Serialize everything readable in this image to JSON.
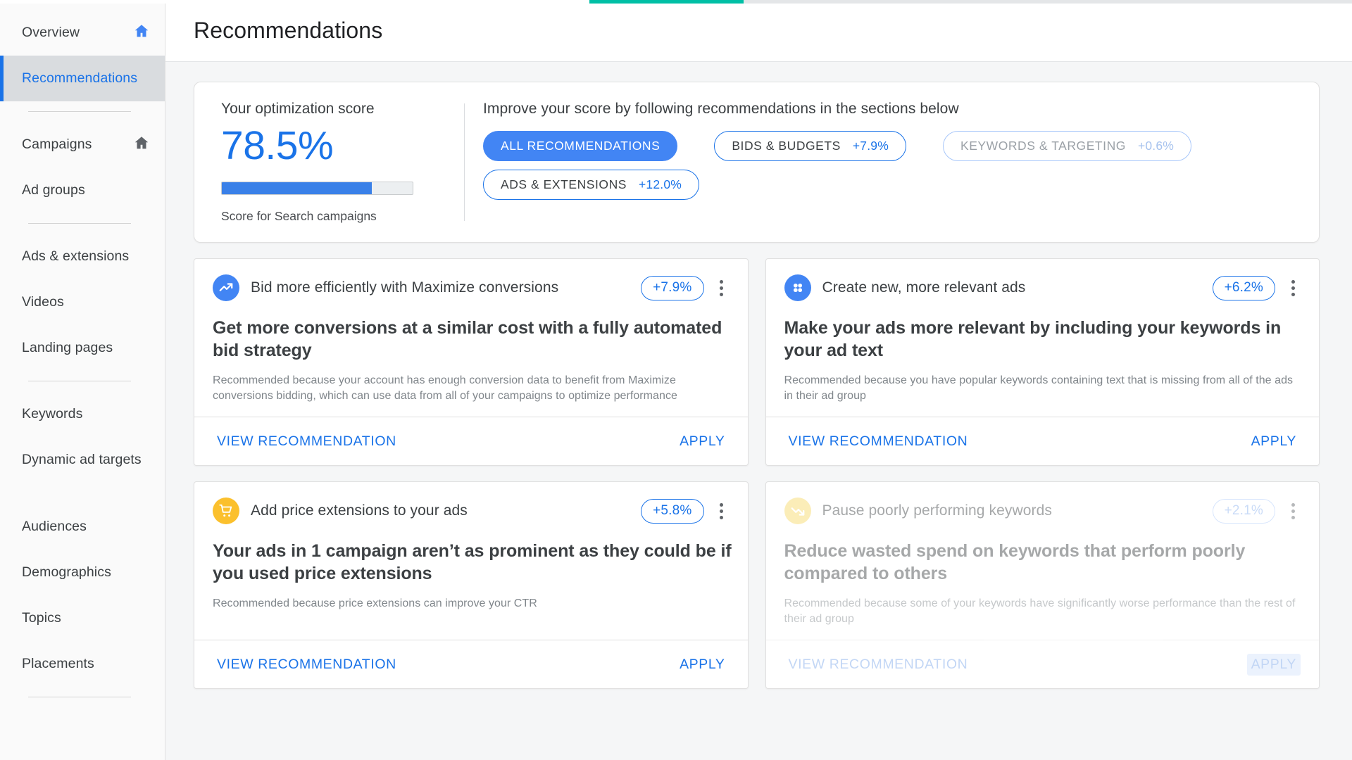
{
  "top_progress": {
    "color": "#00bfa5",
    "percent": 20
  },
  "sidebar": {
    "items": [
      {
        "label": "Overview",
        "icon": "home-icon",
        "icon_color": "#4285f4",
        "active": false,
        "has_icon": true
      },
      {
        "label": "Recommendations",
        "active": true,
        "has_icon": false
      },
      {
        "divider_after": true
      },
      {
        "label": "Campaigns",
        "icon": "home-icon",
        "icon_color": "#5f6368",
        "active": false,
        "has_icon": true
      },
      {
        "label": "Ad groups",
        "active": false,
        "has_icon": false
      },
      {
        "divider_after": true
      },
      {
        "label": "Ads  & extensions",
        "active": false,
        "has_icon": false
      },
      {
        "label": "Videos",
        "active": false,
        "has_icon": false
      },
      {
        "label": "Landing pages",
        "active": false,
        "has_icon": false
      },
      {
        "divider_after": true
      },
      {
        "label": "Keywords",
        "active": false,
        "has_icon": false
      },
      {
        "label": "Dynamic ad targets",
        "active": false,
        "has_icon": false
      },
      {
        "gap_after": true
      },
      {
        "label": "Audiences",
        "active": false,
        "has_icon": false
      },
      {
        "label": "Demographics",
        "active": false,
        "has_icon": false
      },
      {
        "label": "Topics",
        "active": false,
        "has_icon": false
      },
      {
        "label": "Placements",
        "active": false,
        "has_icon": false
      },
      {
        "divider_after": true
      }
    ]
  },
  "header": {
    "title": "Recommendations"
  },
  "score_card": {
    "label": "Your optimization score",
    "value": "78.5%",
    "progress_percent": 78.5,
    "sub_label": "Score for Search campaigns",
    "improve_text": "Improve your score by following recommendations in the sections below",
    "chips": [
      {
        "label": "ALL RECOMMENDATIONS",
        "delta": "",
        "style": "primary"
      },
      {
        "label": "BIDS & BUDGETS",
        "delta": "+7.9%",
        "style": "outline"
      },
      {
        "label": "KEYWORDS & TARGETING",
        "delta": "+0.6%",
        "style": "outline muted"
      },
      {
        "label": "ADS & EXTENSIONS",
        "delta": "+12.0%",
        "style": "outline"
      }
    ]
  },
  "recommendations": {
    "view_label": "VIEW RECOMMENDATION",
    "apply_label": "APPLY",
    "cards": [
      {
        "icon": "trending-up-icon",
        "icon_style": "blue",
        "title": "Bid more efficiently with Maximize conversions",
        "delta": "+7.9%",
        "headline": "Get more conversions at a similar cost with a fully automated bid strategy",
        "reason": "Recommended because your account has enough conversion data to benefit from Maximize conversions bidding, which can use data from all of your campaigns to optimize performance",
        "faded": false,
        "apply_hovered": false
      },
      {
        "icon": "four-dots-icon",
        "icon_style": "blue",
        "title": "Create new, more relevant ads",
        "delta": "+6.2%",
        "headline": "Make your ads more relevant by including your keywords in your ad text",
        "reason": "Recommended because you have popular keywords containing text that is missing from all of the ads in their ad group",
        "faded": false,
        "apply_hovered": false
      },
      {
        "icon": "shopping-cart-icon",
        "icon_style": "yellow",
        "title": "Add price extensions to your ads",
        "delta": "+5.8%",
        "headline": "Your ads in 1 campaign aren’t as prominent as they could be if you used price extensions",
        "reason": "Recommended because price extensions can improve your CTR",
        "faded": false,
        "apply_hovered": false
      },
      {
        "icon": "trending-down-icon",
        "icon_style": "yellow-soft",
        "title": "Pause poorly performing keywords",
        "delta": "+2.1%",
        "headline": "Reduce wasted spend on keywords that perform poorly compared to others",
        "reason": "Recommended because some of your keywords have significantly worse performance than the rest of their ad group",
        "faded": true,
        "apply_hovered": true
      }
    ]
  },
  "colors": {
    "accent_blue": "#1a73e8",
    "chip_blue": "#4285f4",
    "yellow": "#fbc02d",
    "teal": "#00bfa5",
    "text_primary": "#3c4043",
    "text_muted": "#80868b"
  }
}
